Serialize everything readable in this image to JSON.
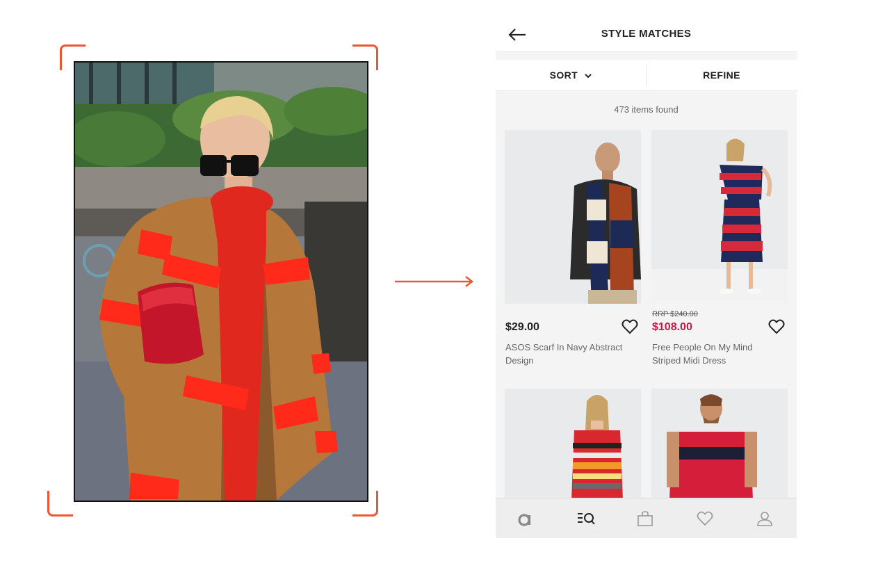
{
  "header": {
    "title": "STYLE MATCHES",
    "back_icon": "arrow-left-icon"
  },
  "toolbar": {
    "sort_label": "SORT",
    "refine_label": "REFINE"
  },
  "results": {
    "count_text": "473 items found"
  },
  "products": [
    {
      "price": "$29.00",
      "rrp": "",
      "name": "ASOS Scarf In Navy Abstract Design",
      "on_sale": false
    },
    {
      "price": "$108.00",
      "rrp": "RRP $240.00",
      "name": "Free People On My Mind Striped Midi Dress",
      "on_sale": true
    },
    {
      "price": "",
      "rrp": "",
      "name": "",
      "on_sale": false
    },
    {
      "price": "",
      "rrp": "",
      "name": "",
      "on_sale": false
    }
  ],
  "bottom_nav": [
    "home-icon",
    "search-style-icon",
    "bag-icon",
    "saved-heart-icon",
    "account-icon"
  ],
  "colors": {
    "accent": "#ee5533",
    "sale": "#d01345",
    "text": "#222222"
  }
}
